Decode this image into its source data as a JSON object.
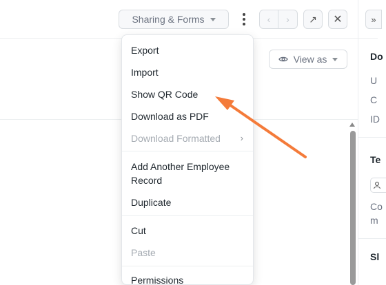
{
  "toolbar": {
    "sharing_label": "Sharing & Forms",
    "prev_glyph": "‹",
    "next_glyph": "›",
    "open_glyph": "↗",
    "close_glyph": "✕",
    "expand_glyph": "»"
  },
  "view_as": {
    "label": "View as"
  },
  "menu": {
    "items": [
      {
        "label": "Export"
      },
      {
        "label": "Import"
      },
      {
        "label": "Show QR Code"
      },
      {
        "label": "Download as PDF"
      },
      {
        "label": "Download Formatted",
        "chevron": "›"
      },
      {
        "label_line1": "Add Another Employee",
        "label_line2": "Record"
      },
      {
        "label": "Duplicate"
      },
      {
        "label": "Cut"
      },
      {
        "label": "Paste"
      },
      {
        "label": "Permissions"
      }
    ]
  },
  "side_panel": {
    "heading1": "Do",
    "line1": "U",
    "line2": "C",
    "line3": "ID",
    "heading2": "Te",
    "text1": "Co",
    "text2": "m",
    "heading3": "Sl"
  },
  "colors": {
    "arrow": "#f47b3a",
    "accent_text": "#1f272e",
    "muted_text": "#6b7280"
  },
  "icons": {
    "eye": "eye-icon",
    "kebab": "kebab-menu-icon",
    "user": "user-icon"
  }
}
